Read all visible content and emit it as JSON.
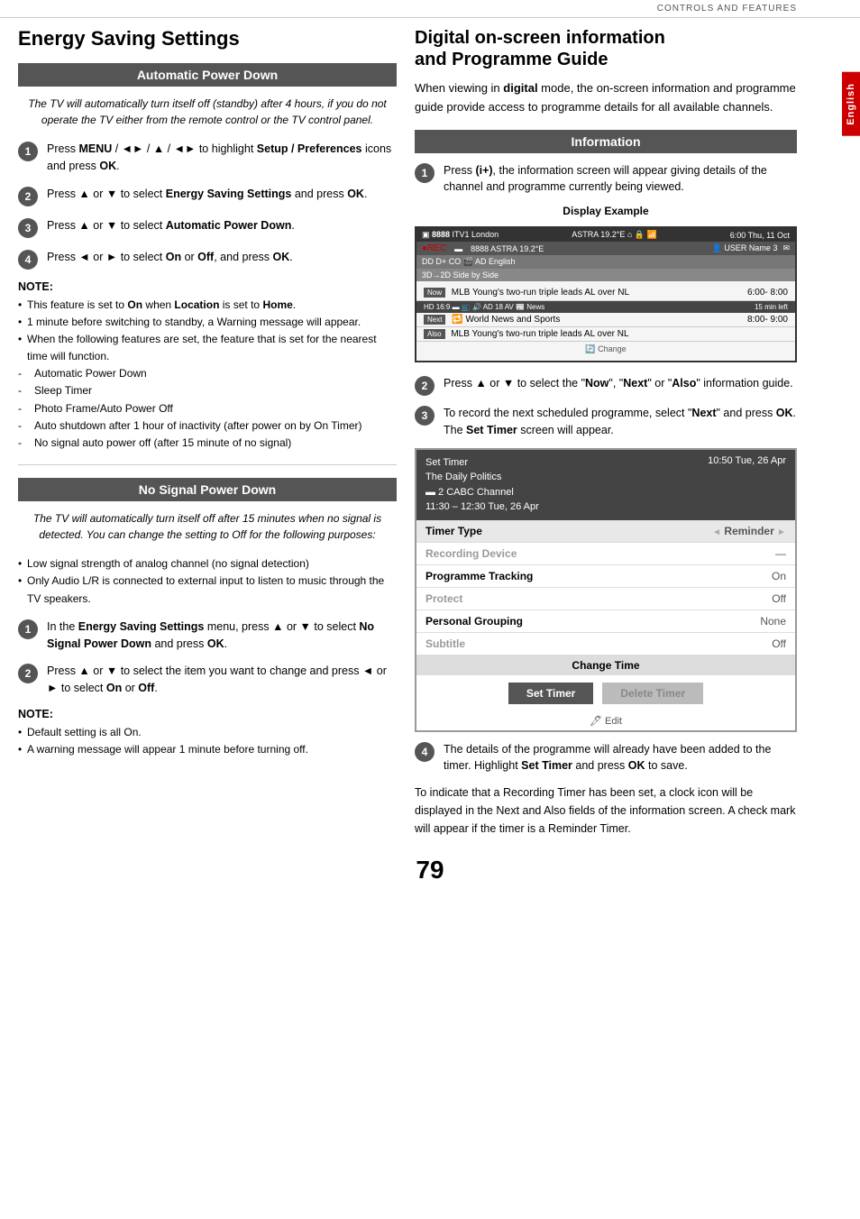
{
  "topBar": {
    "text": "CONTROLS AND FEATURES"
  },
  "englishTab": {
    "label": "English"
  },
  "leftCol": {
    "title": "Energy Saving Settings",
    "autoSection": {
      "header": "Automatic Power Down",
      "italicNote": "The TV will automatically turn itself off (standby) after 4 hours, if you do not operate the TV either from the remote control or the TV control panel.",
      "steps": [
        {
          "num": "1",
          "text": "Press MENU / ◄► / ▲ / ◄► to highlight Setup / Preferences icons and press OK."
        },
        {
          "num": "2",
          "text": "Press ▲ or ▼ to select Energy Saving Settings and press OK."
        },
        {
          "num": "3",
          "text": "Press ▲ or ▼ to select Automatic Power Down."
        },
        {
          "num": "4",
          "text": "Press ◄ or ► to select On or Off, and press OK."
        }
      ],
      "noteTitle": "NOTE:",
      "notes": [
        {
          "type": "bullet",
          "text": "This feature is set to On when Location is set to Home."
        },
        {
          "type": "bullet",
          "text": "1 minute before switching to standby, a Warning message will appear."
        },
        {
          "type": "bullet",
          "text": "When the following features are set, the feature that is set for the nearest time will function."
        },
        {
          "type": "dash",
          "text": "Automatic Power Down"
        },
        {
          "type": "dash",
          "text": "Sleep Timer"
        },
        {
          "type": "dash",
          "text": "Photo Frame/Auto Power Off"
        },
        {
          "type": "dash",
          "text": "Auto shutdown after 1 hour of inactivity (after power on by On Timer)"
        },
        {
          "type": "dash",
          "text": "No signal auto power off (after 15 minute of no signal)"
        }
      ]
    },
    "noSignalSection": {
      "header": "No Signal Power Down",
      "italicNote": "The TV will automatically turn itself off after 15 minutes when no signal is detected. You can change the setting to Off for the following purposes:",
      "bullets": [
        "Low signal strength of analog channel (no signal detection)",
        "Only Audio L/R is connected to external input to listen to music through the TV speakers."
      ],
      "steps": [
        {
          "num": "1",
          "text": "In the Energy Saving Settings menu, press ▲ or ▼ to select No Signal Power Down and press OK."
        },
        {
          "num": "2",
          "text": "Press ▲ or ▼ to select the item you want to change and press ◄ or ► to select On or Off."
        }
      ],
      "noteTitle": "NOTE:",
      "notes": [
        {
          "type": "bullet",
          "text": "Default setting is all On."
        },
        {
          "type": "bullet",
          "text": "A warning message will appear 1 minute before turning off."
        }
      ]
    }
  },
  "rightCol": {
    "title": "Digital on-screen information and Programme Guide",
    "intro": "When viewing in digital mode, the on-screen information and programme guide provide access to programme details for all available channels.",
    "infoSection": {
      "header": "Information",
      "steps": [
        {
          "num": "1",
          "text": "Press (i+), the information screen will appear giving details of the channel and programme currently being viewed."
        },
        {
          "num": "2",
          "text": "Press ▲ or ▼ to select the \"Now\", \"Next\" or \"Also\" information guide."
        },
        {
          "num": "3",
          "text": "To record the next scheduled programme, select \"Next\" and press OK. The Set Timer screen will appear."
        },
        {
          "num": "4",
          "text": "The details of the programme will already have been added to the timer. Highlight Set Timer and press OK to save."
        }
      ],
      "step4Extra": "To indicate that a Recording Timer has been set, a clock icon will be displayed in the Next and Also fields of the information screen. A check mark will appear if the timer is a Reminder Timer."
    },
    "displayExample": {
      "title": "Display Example",
      "topBar": {
        "left": "8888  ITV1 London",
        "middle": "ASTRA 19.2°E  🔒  📶",
        "right": "6:00 Thu, 11 Oct"
      },
      "bar2": {
        "dot": "●REC",
        "channel": "8888 ASTRA 19.2°E",
        "userIcon": "👤 USER Name 3",
        "mailIcon": "✉"
      },
      "bar3": {
        "text": "DD D+  CO  AD English"
      },
      "bar4": {
        "text": "3D→2D Side by Side"
      },
      "nowRow": {
        "label": "Now",
        "text": "MLB Young's two-run triple leads AL over NL",
        "time": "6:00- 8:00"
      },
      "iconsRow": {
        "text": "HD 16:9  📋  📺  🔊 AD  18  AV  📰 News",
        "right": "15 min left"
      },
      "nextRow": {
        "label": "Next",
        "icon": "🔁",
        "text": "World News and Sports",
        "time": "8:00- 9:00"
      },
      "alsoRow": {
        "label": "Also",
        "text": "MLB Young's two-run triple leads AL over NL"
      },
      "changeRow": "Change"
    },
    "setTimer": {
      "headerLeft": "Set Timer\nThe Daily Politics\n2 CABC Channel\n11:30 – 12:30 Tue, 26 Apr",
      "headerRight": "10:50 Tue, 26 Apr",
      "rows": [
        {
          "label": "Timer Type",
          "value": "Reminder",
          "hasArrows": true
        },
        {
          "label": "Recording Device",
          "value": "—",
          "grayed": true
        },
        {
          "label": "Programme Tracking",
          "value": "On",
          "grayed": false
        },
        {
          "label": "Protect",
          "value": "Off",
          "grayed": true
        },
        {
          "label": "Personal Grouping",
          "value": "None",
          "grayed": false
        },
        {
          "label": "Subtitle",
          "value": "Off",
          "grayed": true
        }
      ],
      "changeTime": "Change Time",
      "buttons": {
        "setTimer": "Set Timer",
        "deleteTimer": "Delete Timer"
      },
      "editLabel": "Edit"
    }
  },
  "pageNumber": "79"
}
